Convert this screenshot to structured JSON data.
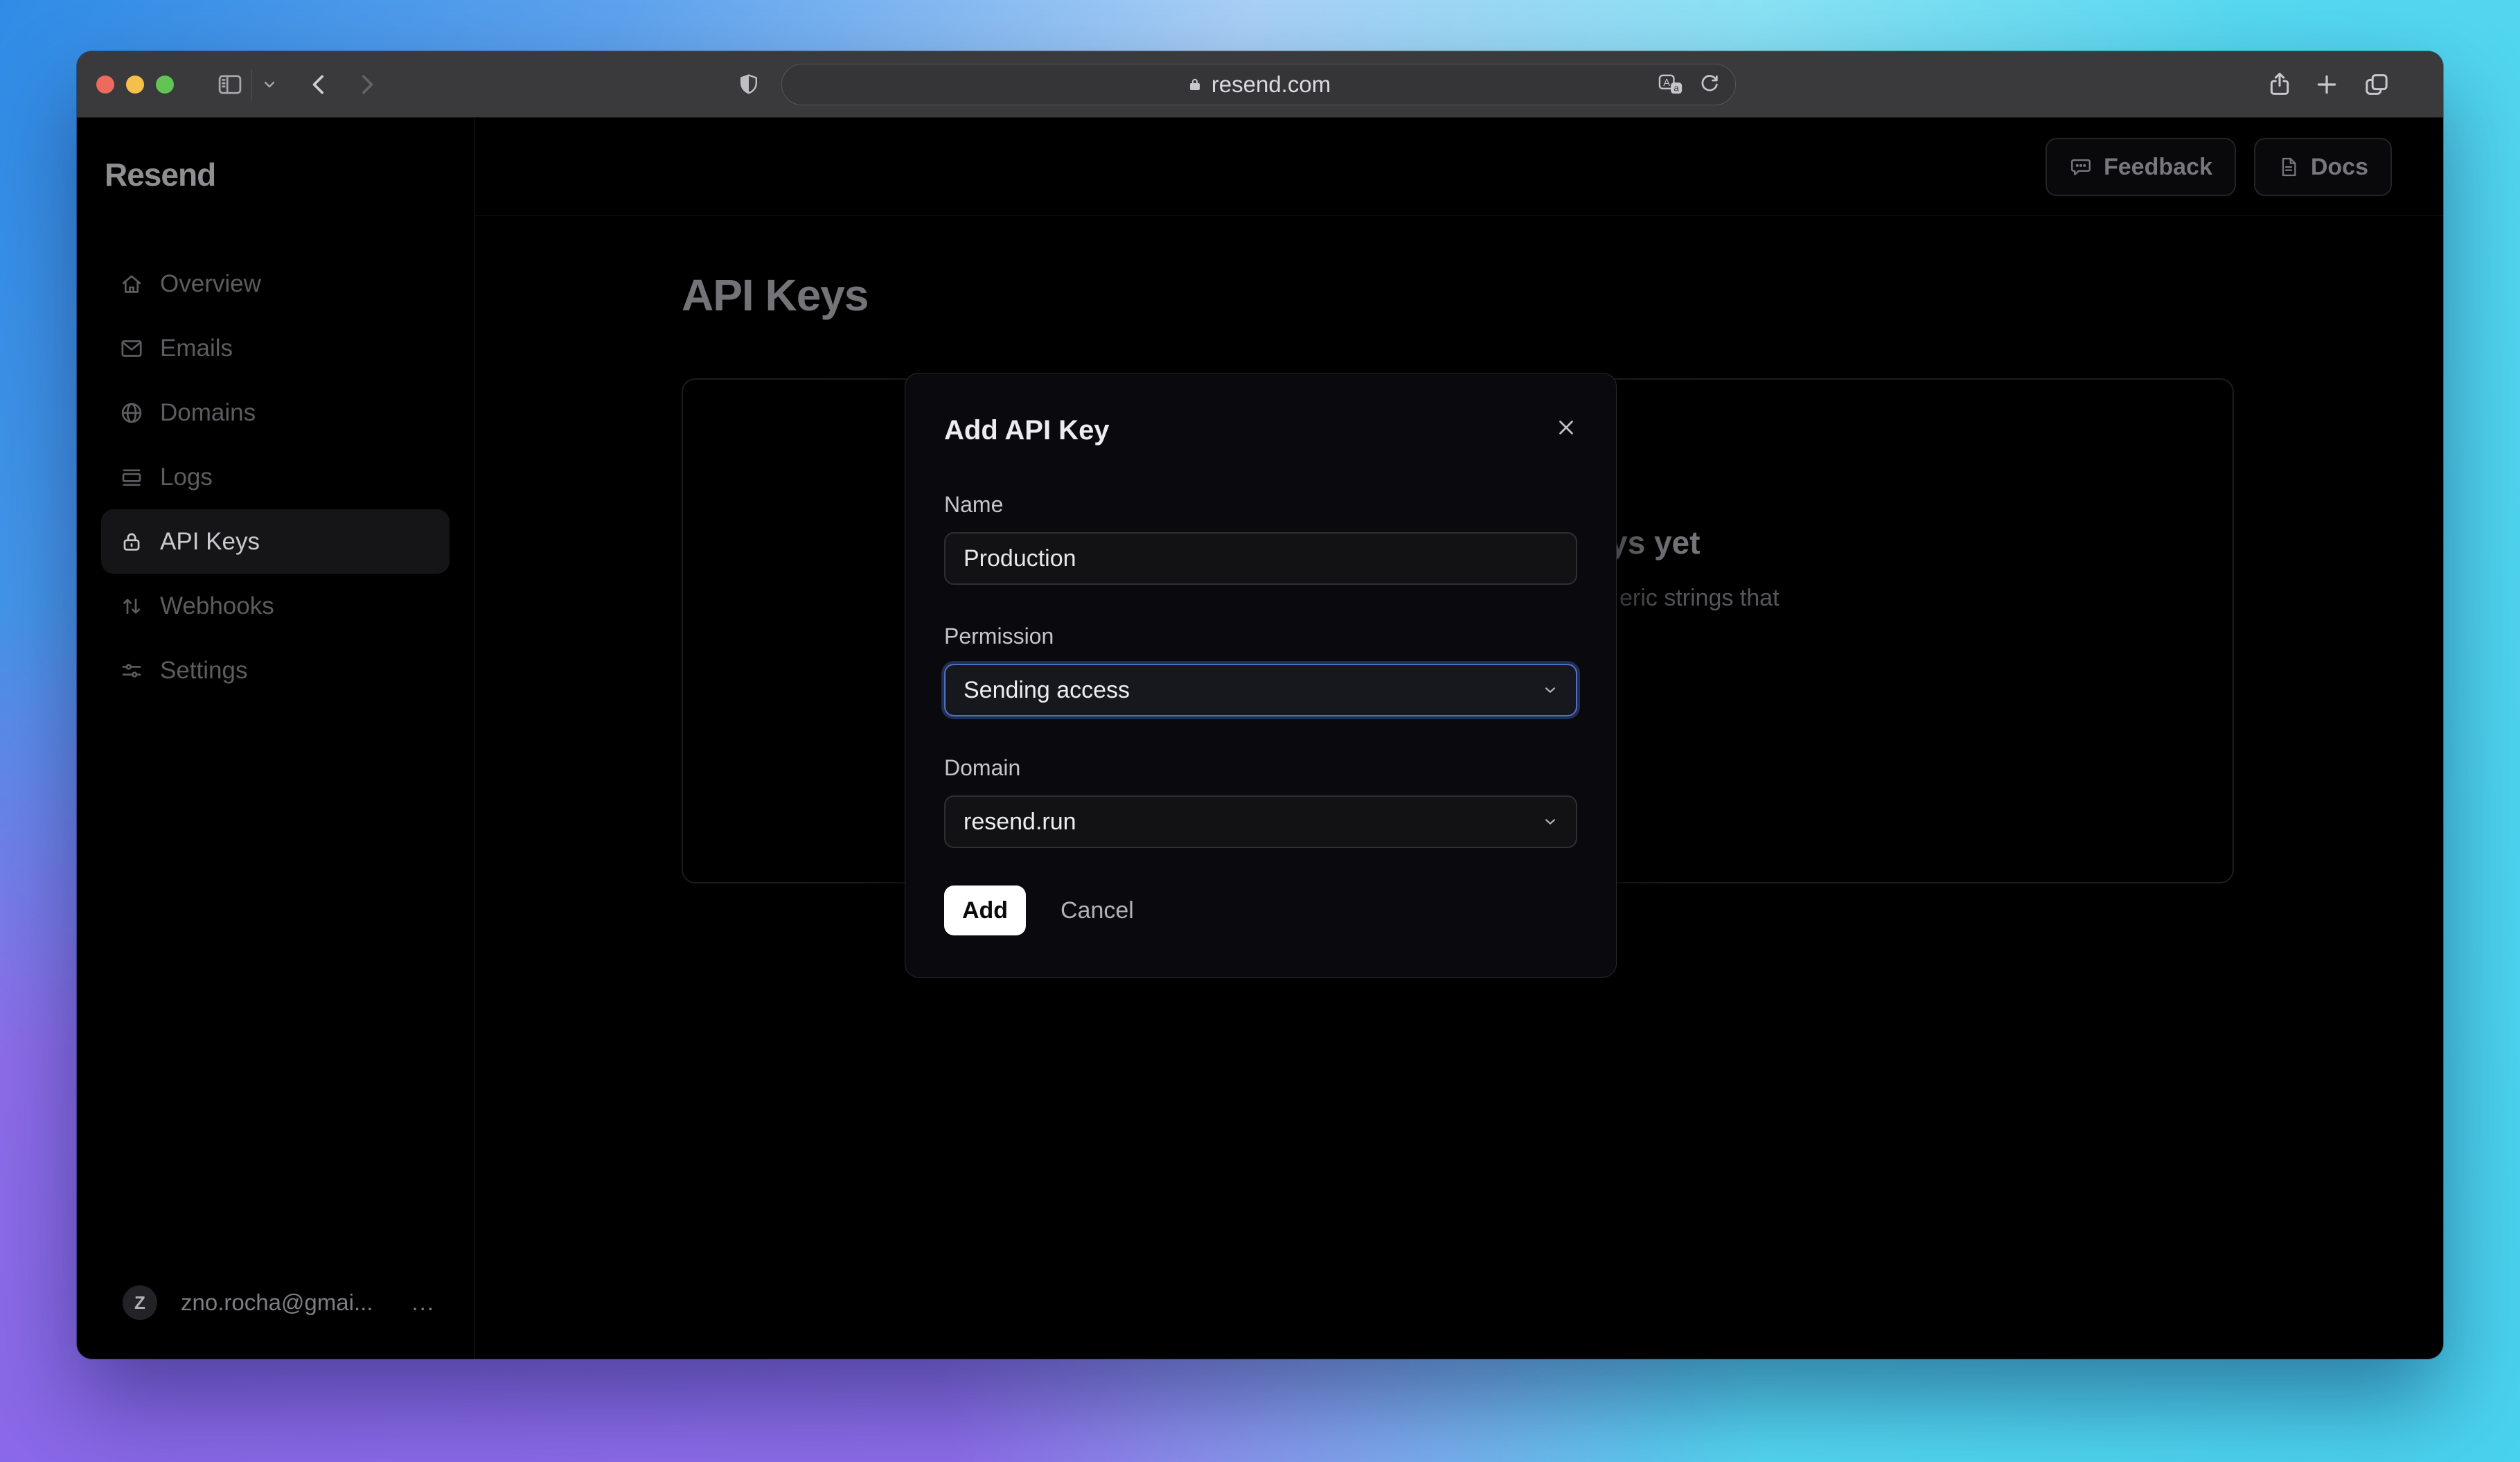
{
  "browser": {
    "url": "resend.com"
  },
  "sidebar": {
    "logo": "Resend",
    "items": [
      {
        "label": "Overview"
      },
      {
        "label": "Emails"
      },
      {
        "label": "Domains"
      },
      {
        "label": "Logs"
      },
      {
        "label": "API Keys"
      },
      {
        "label": "Webhooks"
      },
      {
        "label": "Settings"
      }
    ],
    "user": {
      "initial": "Z",
      "email": "zno.rocha@gmai...",
      "menu": "..."
    }
  },
  "header": {
    "feedback": "Feedback",
    "docs": "Docs"
  },
  "page": {
    "title": "API Keys",
    "empty_state": {
      "heading_fragment": "ys yet",
      "body_fragment": "eric strings that"
    }
  },
  "modal": {
    "title": "Add API Key",
    "name_label": "Name",
    "name_value": "Production",
    "permission_label": "Permission",
    "permission_value": "Sending access",
    "domain_label": "Domain",
    "domain_value": "resend.run",
    "add": "Add",
    "cancel": "Cancel"
  },
  "colors": {
    "focus_ring": "#5070c0",
    "add_button_bg": "#ffffff",
    "traffic": [
      "#ec6a5e",
      "#f5bf4e",
      "#61c454"
    ]
  }
}
